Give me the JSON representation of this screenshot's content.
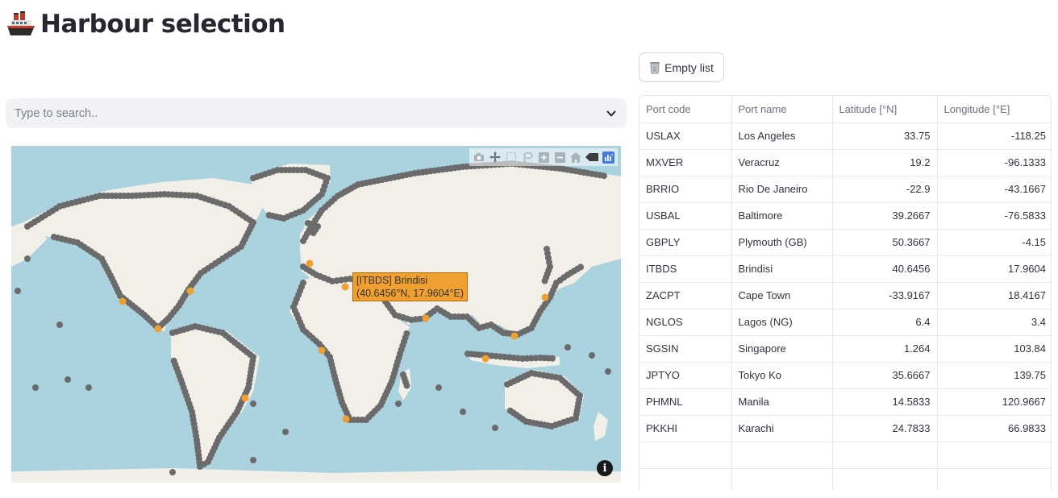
{
  "header": {
    "title": "Harbour selection",
    "title_icon": "ship-icon"
  },
  "toolbar": {
    "empty_label": "Empty list",
    "empty_icon": "wastebasket-icon"
  },
  "search": {
    "placeholder": "Type to search..",
    "value": "",
    "icon": "chevron-down-icon"
  },
  "map": {
    "tooltip_line1": "[ITBDS] Brindisi",
    "tooltip_line2": "(40.6456°N, 17.9604°E)",
    "colors": {
      "water": "#aad3df",
      "land": "#f2efe9",
      "port": "#6b6b6b",
      "selected": "#f0a030"
    },
    "modebar_icons": [
      "camera-icon",
      "pan-icon",
      "box-select-icon",
      "lasso-icon",
      "zoom-in-icon",
      "zoom-out-icon",
      "home-icon",
      "toggle-hover-icon",
      "plotly-logo-icon"
    ]
  },
  "table": {
    "columns": [
      "Port code",
      "Port name",
      "Latitude [°N]",
      "Longitude [°E]"
    ],
    "rows": [
      [
        "USLAX",
        "Los Angeles",
        "33.75",
        "-118.25"
      ],
      [
        "MXVER",
        "Veracruz",
        "19.2",
        "-96.1333"
      ],
      [
        "BRRIO",
        "Rio De Janeiro",
        "-22.9",
        "-43.1667"
      ],
      [
        "USBAL",
        "Baltimore",
        "39.2667",
        "-76.5833"
      ],
      [
        "GBPLY",
        "Plymouth (GB)",
        "50.3667",
        "-4.15"
      ],
      [
        "ITBDS",
        "Brindisi",
        "40.6456",
        "17.9604"
      ],
      [
        "ZACPT",
        "Cape Town",
        "-33.9167",
        "18.4167"
      ],
      [
        "NGLOS",
        "Lagos (NG)",
        "6.4",
        "3.4"
      ],
      [
        "SGSIN",
        "Singapore",
        "1.264",
        "103.84"
      ],
      [
        "JPTYO",
        "Tokyo Ko",
        "35.6667",
        "139.75"
      ],
      [
        "PHMNL",
        "Manila",
        "14.5833",
        "120.9667"
      ],
      [
        "PKKHI",
        "Karachi",
        "24.7833",
        "66.9833"
      ],
      [
        "",
        "",
        "",
        ""
      ],
      [
        "",
        "",
        "",
        ""
      ]
    ]
  }
}
